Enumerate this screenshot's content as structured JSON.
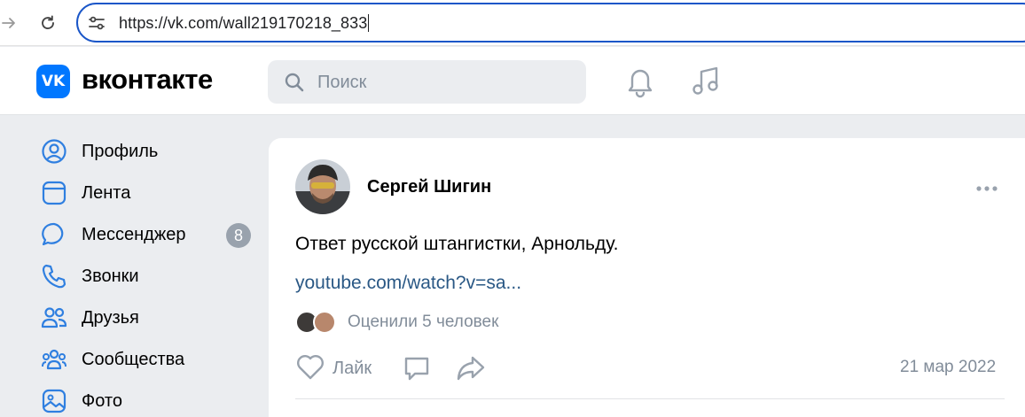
{
  "browser": {
    "url": "https://vk.com/wall219170218_833"
  },
  "header": {
    "logo_letters": "VK",
    "wordmark": "вконтакте",
    "search_placeholder": "Поиск",
    "brand_color": "#0077ff"
  },
  "sidebar": {
    "items": [
      {
        "label": "Профиль",
        "icon": "profile-icon"
      },
      {
        "label": "Лента",
        "icon": "news-icon"
      },
      {
        "label": "Мессенджер",
        "icon": "messenger-icon",
        "badge": "8"
      },
      {
        "label": "Звонки",
        "icon": "phone-icon"
      },
      {
        "label": "Друзья",
        "icon": "friends-icon"
      },
      {
        "label": "Сообщества",
        "icon": "communities-icon"
      },
      {
        "label": "Фото",
        "icon": "photo-icon"
      }
    ]
  },
  "post": {
    "author": "Сергей Шигин",
    "text": "Ответ русской штангистки, Арнольду.",
    "link": "youtube.com/watch?v=sa...",
    "likes_text": "Оценили 5 человек",
    "like_label": "Лайк",
    "date": "21 мар 2022",
    "link_color": "#2a5885"
  }
}
